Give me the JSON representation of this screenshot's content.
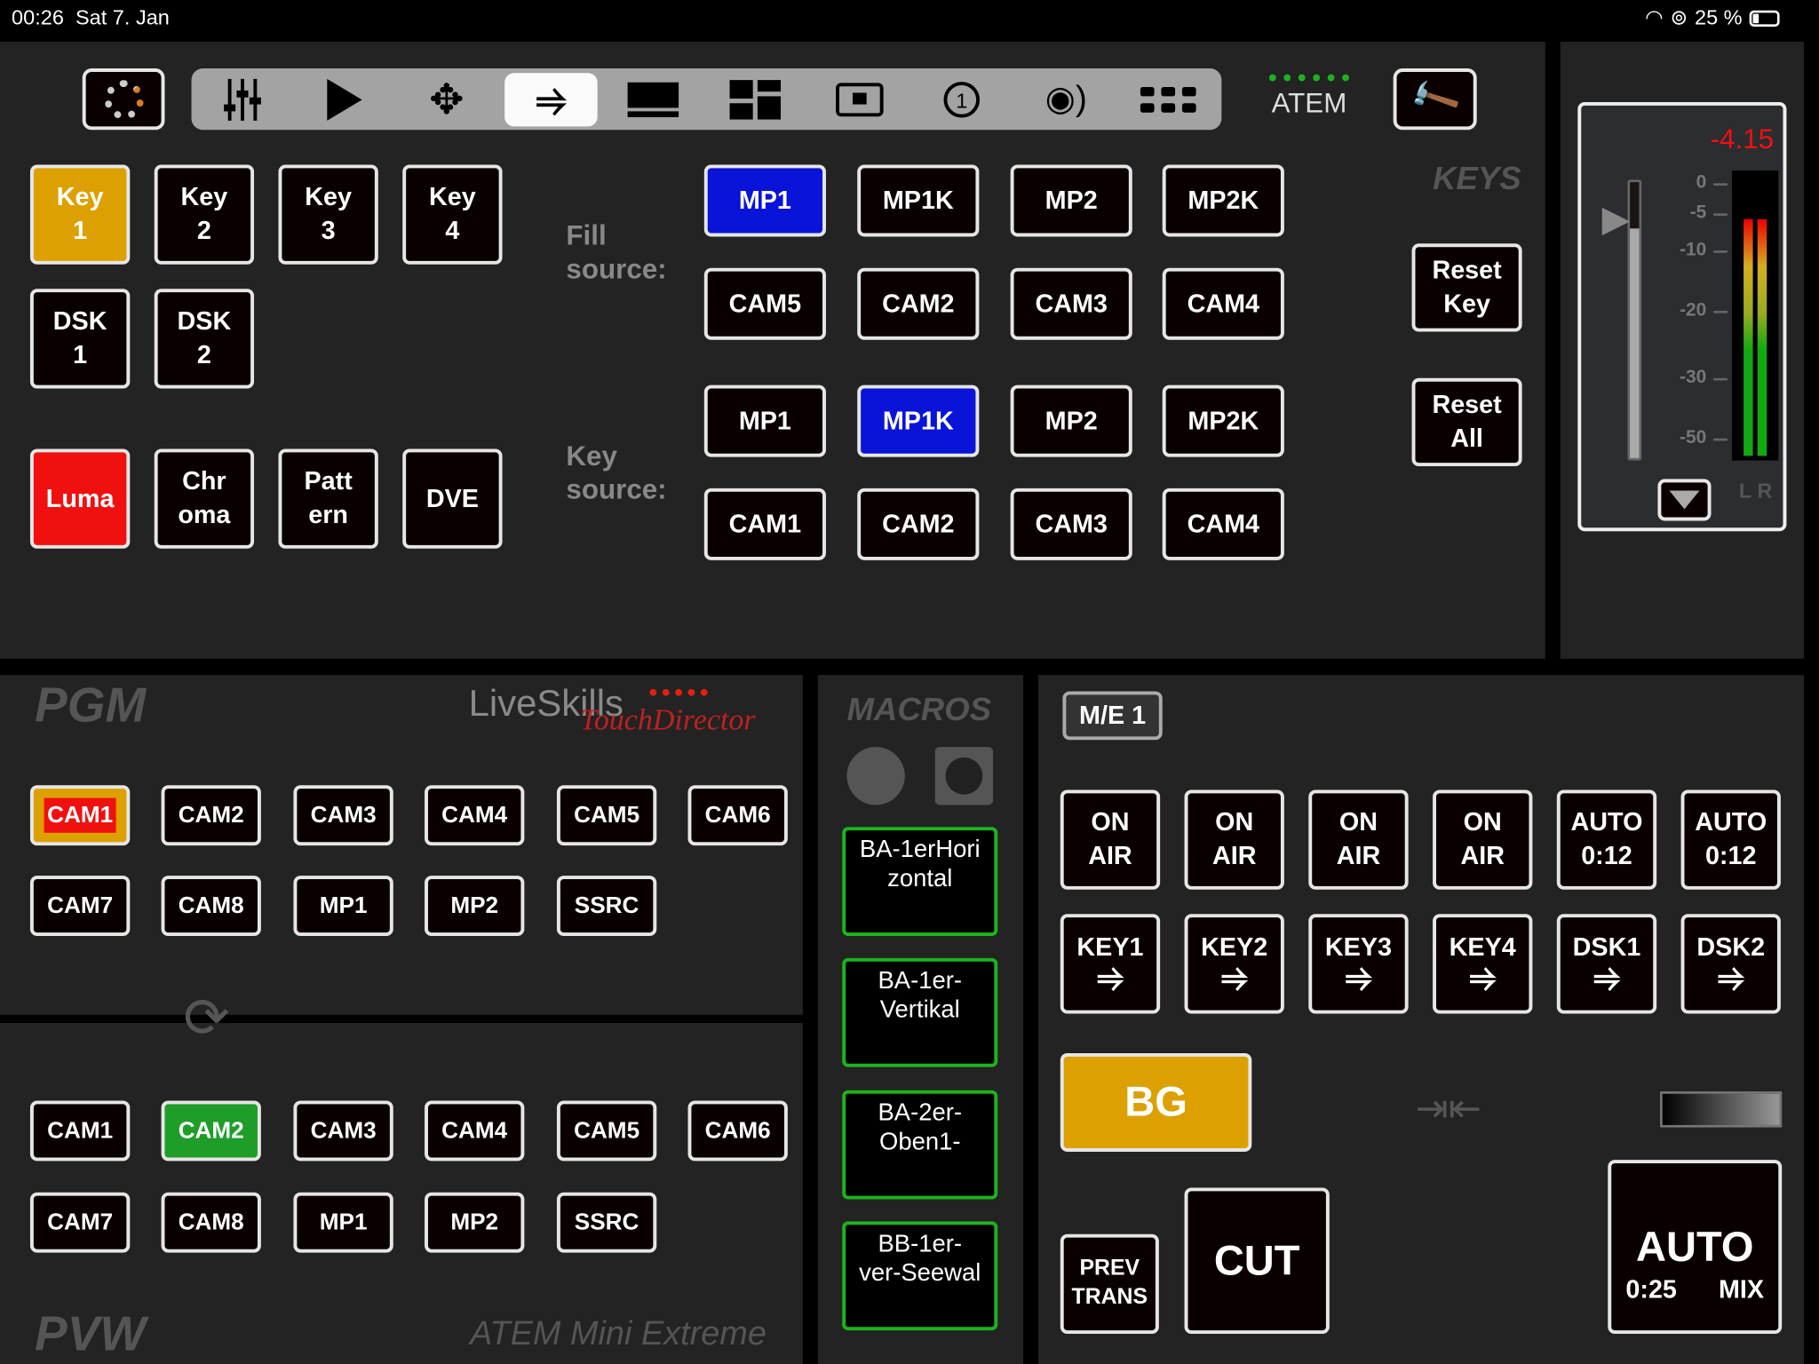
{
  "status_bar": {
    "time": "00:26",
    "date": "Sat 7. Jan",
    "battery": "25 %"
  },
  "toolbar": {
    "icons": [
      "mixer-icon",
      "play-icon",
      "move-icon",
      "key-icon",
      "supersource-icon",
      "multiview-icon",
      "pip-icon",
      "number-one-icon",
      "audio-icon",
      "grid-icon"
    ],
    "active": "key-icon",
    "device_label": "ATEM"
  },
  "keys": {
    "key_buttons": [
      {
        "label": "Key\n1",
        "active": true
      },
      {
        "label": "Key\n2"
      },
      {
        "label": "Key\n3"
      },
      {
        "label": "Key\n4"
      }
    ],
    "dsk_buttons": [
      {
        "label": "DSK\n1"
      },
      {
        "label": "DSK\n2"
      }
    ],
    "type_buttons": [
      {
        "label": "Luma",
        "active": true
      },
      {
        "label": "Chr\noma"
      },
      {
        "label": "Patt\nern"
      },
      {
        "label": "DVE"
      }
    ],
    "fill_label": "Fill\nsource:",
    "key_label": "Key\nsource:",
    "fill_sources": [
      [
        "MP1",
        "MP1K",
        "MP2",
        "MP2K"
      ],
      [
        "CAM5",
        "CAM2",
        "CAM3",
        "CAM4"
      ]
    ],
    "fill_selected": "MP1",
    "key_sources": [
      [
        "MP1",
        "MP1K",
        "MP2",
        "MP2K"
      ],
      [
        "CAM1",
        "CAM2",
        "CAM3",
        "CAM4"
      ]
    ],
    "key_selected": "MP1K",
    "section_title": "KEYS",
    "reset_key": "Reset\nKey",
    "reset_all": "Reset\nAll"
  },
  "audio": {
    "level": "-4.15",
    "scale": [
      "0",
      "-5",
      "-10",
      "-20",
      "-30",
      "-50"
    ],
    "channels": "L R",
    "fader_db": -4.15,
    "meter_db": -6
  },
  "pgm": {
    "title": "PGM",
    "logo_text": "LiveSkills",
    "logo_script": "TouchDirector",
    "row1": [
      "CAM1",
      "CAM2",
      "CAM3",
      "CAM4",
      "CAM5",
      "CAM6"
    ],
    "row2": [
      "CAM7",
      "CAM8",
      "MP1",
      "MP2",
      "SSRC"
    ],
    "selected": "CAM1"
  },
  "pvw": {
    "title": "PVW",
    "device_name": "ATEM Mini Extreme",
    "row1": [
      "CAM1",
      "CAM2",
      "CAM3",
      "CAM4",
      "CAM5",
      "CAM6"
    ],
    "row2": [
      "CAM7",
      "CAM8",
      "MP1",
      "MP2",
      "SSRC"
    ],
    "selected": "CAM2"
  },
  "macros": {
    "title": "MACROS",
    "items": [
      "BA-1erHori\nzontal",
      "BA-1er-\nVertikal",
      "BA-2er-\nOben1-",
      "BB-1er-\nver-Seewal"
    ]
  },
  "me": {
    "label": "M/E 1",
    "on_air": [
      "ON\nAIR",
      "ON\nAIR",
      "ON\nAIR",
      "ON\nAIR",
      "AUTO\n0:12",
      "AUTO\n0:12"
    ],
    "keys": [
      "KEY1",
      "KEY2",
      "KEY3",
      "KEY4",
      "DSK1",
      "DSK2"
    ],
    "bg": "BG",
    "prev_trans": "PREV\nTRANS",
    "cut": "CUT",
    "auto": "AUTO",
    "auto_time": "0:25",
    "auto_type": "MIX"
  },
  "colors": {
    "active_orange": "#dca000",
    "luma_red": "#f01010",
    "selected_blue": "#0a14d8",
    "pvw_green": "#1e9e28",
    "macro_border": "#1db31d"
  }
}
